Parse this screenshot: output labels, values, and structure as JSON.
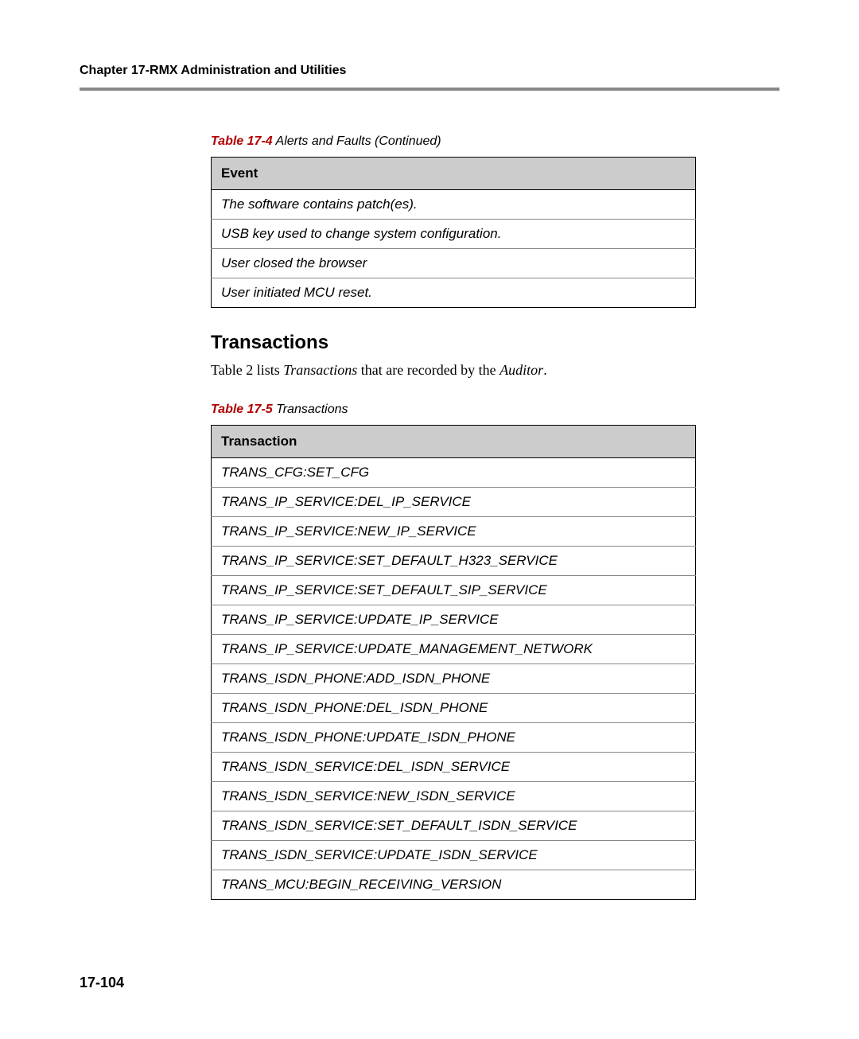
{
  "chapter": "Chapter 17-RMX Administration and Utilities",
  "table1": {
    "caption_num": "Table 17-4",
    "caption_text": "Alerts and Faults (Continued)",
    "header": "Event",
    "rows": [
      "The software contains patch(es).",
      "USB key used to change system configuration.",
      "User closed the browser",
      "User initiated MCU reset."
    ]
  },
  "section_heading": "Transactions",
  "body": {
    "prefix": "Table 2 lists ",
    "em1": "Transactions",
    "mid": " that are recorded by the ",
    "em2": "Auditor",
    "suffix": "."
  },
  "table2": {
    "caption_num": "Table 17-5",
    "caption_text": "Transactions",
    "header": "Transaction",
    "rows": [
      "TRANS_CFG:SET_CFG",
      "TRANS_IP_SERVICE:DEL_IP_SERVICE",
      "TRANS_IP_SERVICE:NEW_IP_SERVICE",
      "TRANS_IP_SERVICE:SET_DEFAULT_H323_SERVICE",
      "TRANS_IP_SERVICE:SET_DEFAULT_SIP_SERVICE",
      "TRANS_IP_SERVICE:UPDATE_IP_SERVICE",
      "TRANS_IP_SERVICE:UPDATE_MANAGEMENT_NETWORK",
      "TRANS_ISDN_PHONE:ADD_ISDN_PHONE",
      "TRANS_ISDN_PHONE:DEL_ISDN_PHONE",
      "TRANS_ISDN_PHONE:UPDATE_ISDN_PHONE",
      "TRANS_ISDN_SERVICE:DEL_ISDN_SERVICE",
      "TRANS_ISDN_SERVICE:NEW_ISDN_SERVICE",
      "TRANS_ISDN_SERVICE:SET_DEFAULT_ISDN_SERVICE",
      "TRANS_ISDN_SERVICE:UPDATE_ISDN_SERVICE",
      "TRANS_MCU:BEGIN_RECEIVING_VERSION"
    ]
  },
  "page_number": "17-104"
}
